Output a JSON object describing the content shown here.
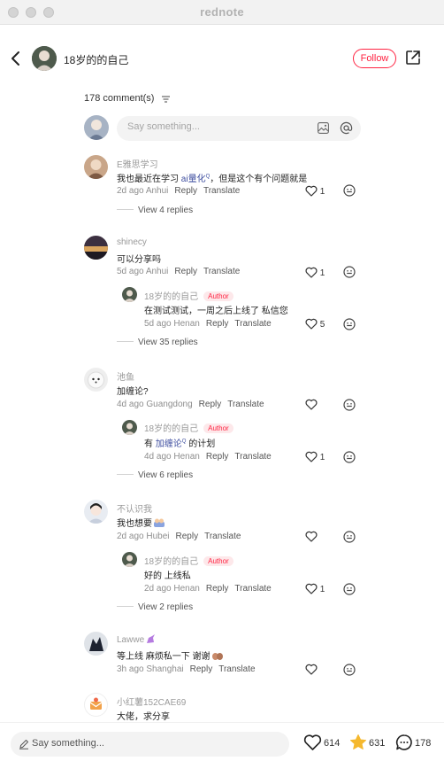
{
  "window": {
    "title": "rednote"
  },
  "header": {
    "author_name": "18岁的的自己",
    "follow_label": "Follow"
  },
  "comments_header": {
    "count_label": "178 comment(s)"
  },
  "composer": {
    "placeholder": "Say something..."
  },
  "comments": [
    {
      "username": "E雅思学习",
      "text_before": "我也最近在学习 ",
      "tag": "ai量化",
      "text_after": "，但是这个有个问题就是",
      "time": "2d ago",
      "location": "Anhui",
      "reply": "Reply",
      "translate": "Translate",
      "likes": "1",
      "view_replies": "View 4 replies"
    },
    {
      "username": "shinecy",
      "text": "可以分享吗",
      "time": "5d ago",
      "location": "Anhui",
      "reply": "Reply",
      "translate": "Translate",
      "likes": "1",
      "sub": {
        "username": "18岁的的自己",
        "badge": "Author",
        "text": "在测试测试，一周之后上线了 私信您",
        "time": "5d ago",
        "location": "Henan",
        "reply": "Reply",
        "translate": "Translate",
        "likes": "5"
      },
      "view_replies": "View 35 replies"
    },
    {
      "username": "池鱼",
      "text": "加缠论?",
      "time": "4d ago",
      "location": "Guangdong",
      "reply": "Reply",
      "translate": "Translate",
      "likes": "",
      "sub": {
        "username": "18岁的的自己",
        "badge": "Author",
        "text_before": "有 ",
        "tag": "加缠论",
        "text_after": " 的计划",
        "time": "4d ago",
        "location": "Henan",
        "reply": "Reply",
        "translate": "Translate",
        "likes": "1"
      },
      "view_replies": "View 6 replies"
    },
    {
      "username": "不认识我",
      "text": "我也想要",
      "time": "2d ago",
      "location": "Hubei",
      "reply": "Reply",
      "translate": "Translate",
      "likes": "",
      "sub": {
        "username": "18岁的的自己",
        "badge": "Author",
        "text": "好的 上线私",
        "time": "2d ago",
        "location": "Henan",
        "reply": "Reply",
        "translate": "Translate",
        "likes": "1"
      },
      "view_replies": "View 2 replies"
    },
    {
      "username": "Lawwe",
      "text": "等上线 麻烦私一下 谢谢",
      "time": "3h ago",
      "location": "Shanghai",
      "reply": "Reply",
      "translate": "Translate",
      "likes": ""
    },
    {
      "username": "小红薯152CAE69",
      "text": "大佬，求分享"
    }
  ],
  "bottom_bar": {
    "placeholder": "Say something...",
    "likes": "614",
    "stars": "631",
    "comments": "178"
  },
  "colors": {
    "brand": "#ff2442",
    "tag": "#3d4d9f",
    "star": "#f5b82e"
  },
  "icons": [
    "back-icon",
    "share-icon",
    "sort-icon",
    "image-icon",
    "at-icon",
    "heart-icon",
    "emoji-icon",
    "pencil-icon",
    "star-icon",
    "comment-icon"
  ]
}
